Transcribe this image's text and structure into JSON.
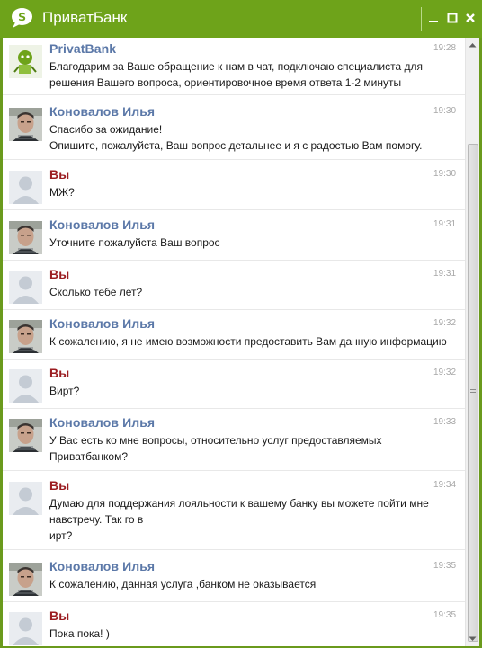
{
  "window": {
    "title": "ПриватБанк",
    "accent_color": "#6ea31a",
    "controls": [
      "minimize-icon",
      "maximize-icon",
      "close-icon"
    ]
  },
  "messages": [
    {
      "sender": "PrivatBank",
      "role": "bank",
      "avatar": "privatbank-logo-avatar",
      "time": "19:28",
      "text": "Благодарим за Ваше обращение к нам в чат, подключаю специалиста для решения Вашего вопроса, ориентировочное время ответа 1-2 минуты"
    },
    {
      "sender": "Коновалов Илья",
      "role": "agent",
      "avatar": "agent-photo-avatar",
      "time": "19:30",
      "text": "Спасибо за ожидание!\nОпишите, пожалуйста, Ваш вопрос детальнее и я с радостью Вам помогу."
    },
    {
      "sender": "Вы",
      "role": "me",
      "avatar": "default-user-avatar",
      "time": "19:30",
      "text": "МЖ?"
    },
    {
      "sender": "Коновалов Илья",
      "role": "agent",
      "avatar": "agent-photo-avatar",
      "time": "19:31",
      "text": "Уточните пожалуйста Ваш вопрос"
    },
    {
      "sender": "Вы",
      "role": "me",
      "avatar": "default-user-avatar",
      "time": "19:31",
      "text": "Сколько тебе лет?"
    },
    {
      "sender": "Коновалов Илья",
      "role": "agent",
      "avatar": "agent-photo-avatar",
      "time": "19:32",
      "text": "К сожалению, я не имею возможности предоставить Вам данную информацию"
    },
    {
      "sender": "Вы",
      "role": "me",
      "avatar": "default-user-avatar",
      "time": "19:32",
      "text": "Вирт?"
    },
    {
      "sender": "Коновалов Илья",
      "role": "agent",
      "avatar": "agent-photo-avatar",
      "time": "19:33",
      "text": "У Вас есть ко мне вопросы, относительно услуг предоставляемых Приватбанком?"
    },
    {
      "sender": "Вы",
      "role": "me",
      "avatar": "default-user-avatar",
      "time": "19:34",
      "text": "Думаю для поддержания лояльности к вашему банку вы можете пойти мне навстречу. Так го в\nирт?"
    },
    {
      "sender": "Коновалов Илья",
      "role": "agent",
      "avatar": "agent-photo-avatar",
      "time": "19:35",
      "text": "К сожалению, данная услуга ,банком не оказывается"
    },
    {
      "sender": "Вы",
      "role": "me",
      "avatar": "default-user-avatar",
      "time": "19:35",
      "text": "Пока пока! )"
    }
  ]
}
